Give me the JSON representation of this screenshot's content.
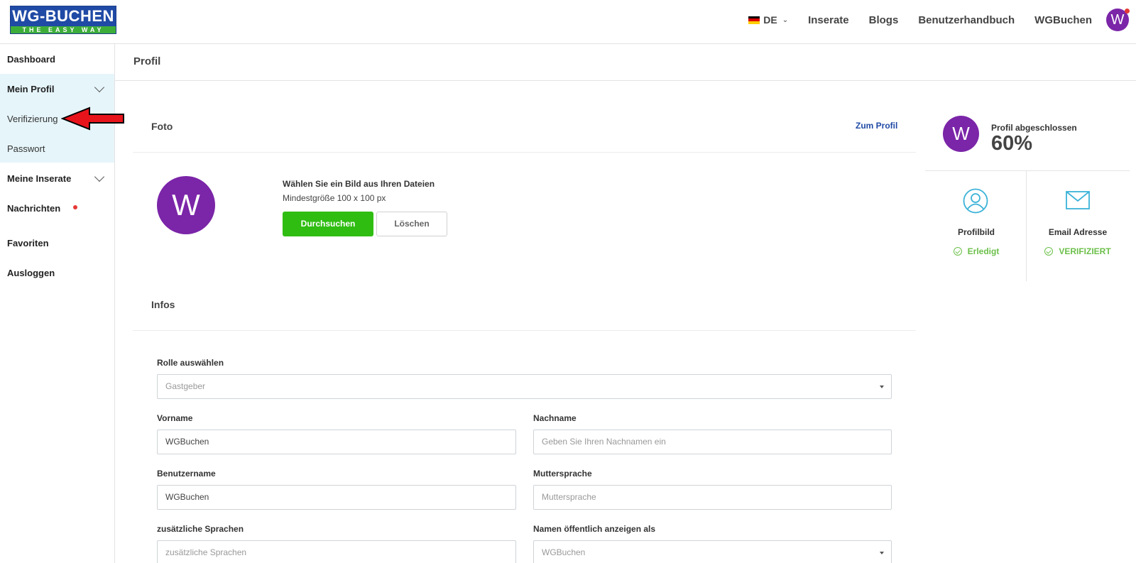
{
  "header": {
    "logo_top": "WG-BUCHEN",
    "logo_bottom": "THE EASY WAY",
    "language": "DE",
    "nav": [
      "Inserate",
      "Blogs",
      "Benutzerhandbuch",
      "WGBuchen"
    ],
    "avatar_letter": "W"
  },
  "sidebar": {
    "items": [
      {
        "label": "Dashboard"
      },
      {
        "label": "Mein Profil"
      },
      {
        "label": "Verifizierung"
      },
      {
        "label": "Passwort"
      },
      {
        "label": "Meine Inserate"
      },
      {
        "label": "Nachrichten"
      },
      {
        "label": "Favoriten"
      },
      {
        "label": "Ausloggen"
      }
    ]
  },
  "page": {
    "title": "Profil"
  },
  "photo": {
    "section_title": "Foto",
    "profile_link": "Zum Profil",
    "avatar_letter": "W",
    "choose_text": "Wählen Sie ein Bild aus Ihren Dateien",
    "min_size": "Mindestgröße 100 x 100 px",
    "browse_label": "Durchsuchen",
    "delete_label": "Löschen"
  },
  "infos": {
    "section_title": "Infos",
    "role": {
      "label": "Rolle auswählen",
      "value": "Gastgeber"
    },
    "firstname": {
      "label": "Vorname",
      "value": "WGBuchen"
    },
    "lastname": {
      "label": "Nachname",
      "placeholder": "Geben Sie Ihren Nachnamen ein"
    },
    "username": {
      "label": "Benutzername",
      "value": "WGBuchen"
    },
    "native_language": {
      "label": "Muttersprache",
      "placeholder": "Muttersprache"
    },
    "additional_languages": {
      "label": "zusätzliche Sprachen",
      "placeholder": "zusätzliche Sprachen"
    },
    "public_name": {
      "label": "Namen öffentlich anzeigen als",
      "value": "WGBuchen"
    }
  },
  "completion": {
    "avatar_letter": "W",
    "label": "Profil abgeschlossen",
    "percent": "60%",
    "items": [
      {
        "title": "Profilbild",
        "status": "Erledigt"
      },
      {
        "title": "Email Adresse",
        "status": "VERIFIZIERT"
      }
    ]
  },
  "colors": {
    "accent_purple": "#7b25a8",
    "primary_green": "#2fbd12",
    "link_blue": "#1f4aa5",
    "status_green": "#6cc04a",
    "icon_cyan": "#3bb2d8",
    "highlight_bg": "#e6f5fa",
    "annotation_red": "#e8141c"
  },
  "icons": {
    "language_flag": "germany-flag-icon",
    "notification": "notification-dot-icon",
    "profile_picture": "user-circle-icon",
    "email": "envelope-icon",
    "done": "check-circle-icon",
    "annotation": "red-arrow-icon"
  }
}
